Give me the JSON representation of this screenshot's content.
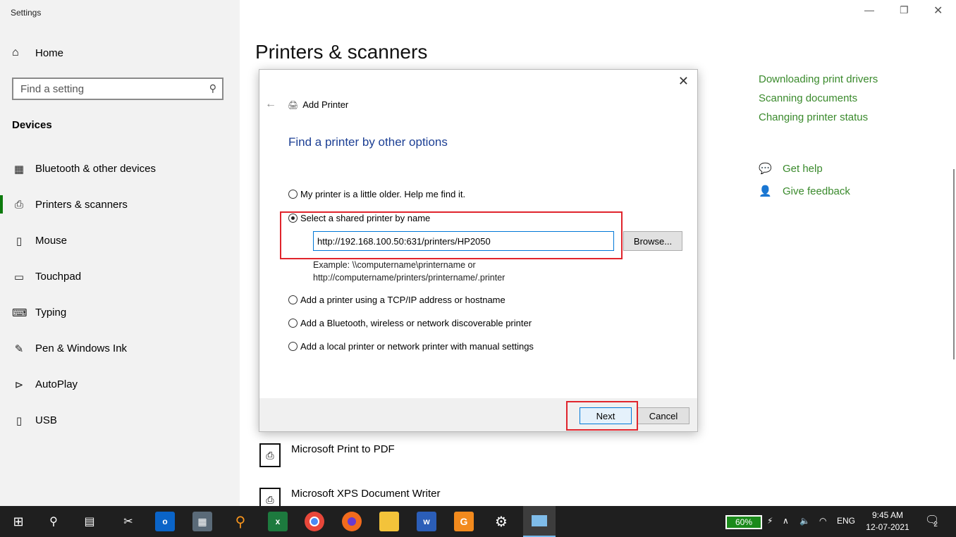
{
  "app_title": "Settings",
  "sidebar": {
    "home_label": "Home",
    "search_placeholder": "Find a setting",
    "section_title": "Devices",
    "items": [
      {
        "label": "Bluetooth & other devices",
        "icon": "bluetooth-devices-icon"
      },
      {
        "label": "Printers & scanners",
        "icon": "printer-icon"
      },
      {
        "label": "Mouse",
        "icon": "mouse-icon"
      },
      {
        "label": "Touchpad",
        "icon": "touchpad-icon"
      },
      {
        "label": "Typing",
        "icon": "keyboard-icon"
      },
      {
        "label": "Pen & Windows Ink",
        "icon": "pen-icon"
      },
      {
        "label": "AutoPlay",
        "icon": "autoplay-icon"
      },
      {
        "label": "USB",
        "icon": "usb-icon"
      }
    ]
  },
  "main": {
    "title": "Printers & scanners",
    "related_links": [
      "Downloading print drivers",
      "Scanning documents",
      "Changing printer status"
    ],
    "help": {
      "get_help": "Get help",
      "give_feedback": "Give feedback"
    },
    "printers": [
      "Microsoft Print to PDF",
      "Microsoft XPS Document Writer"
    ]
  },
  "dialog": {
    "title": "Add Printer",
    "heading": "Find a printer by other options",
    "options": [
      "My printer is a little older. Help me find it.",
      "Select a shared printer by name",
      "Add a printer using a TCP/IP address or hostname",
      "Add a Bluetooth, wireless or network discoverable printer",
      "Add a local printer or network printer with manual settings"
    ],
    "selected_option": 1,
    "url_value": "http://192.168.100.50:631/printers/HP2050",
    "browse_label": "Browse...",
    "example_line1": "Example: \\\\computername\\printername or",
    "example_line2": "http://computername/printers/printername/.printer",
    "next_label": "Next",
    "cancel_label": "Cancel"
  },
  "taskbar": {
    "battery": "60%",
    "language": "ENG",
    "time": "9:45 AM",
    "date": "12-07-2021",
    "notification_count": "2"
  }
}
